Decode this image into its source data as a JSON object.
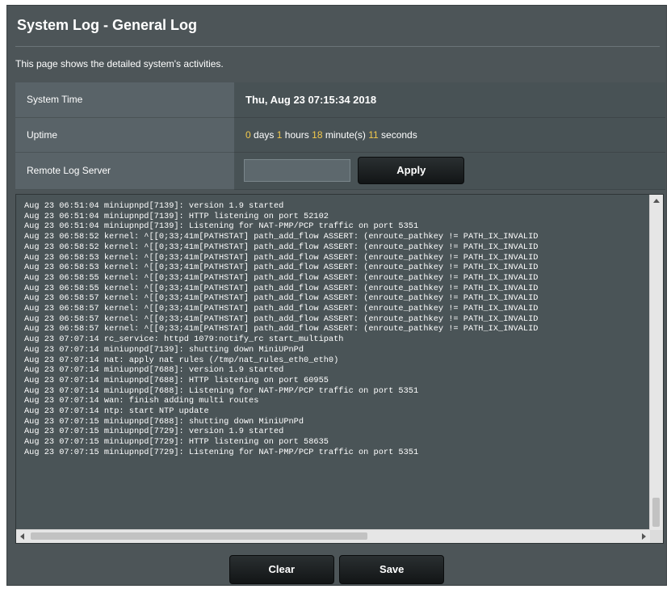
{
  "page": {
    "title": "System Log - General Log",
    "description": "This page shows the detailed system's activities."
  },
  "info": {
    "system_time_label": "System Time",
    "system_time_value": "Thu, Aug 23 07:15:34 2018",
    "uptime_label": "Uptime",
    "uptime": {
      "days": "0",
      "days_unit": "days",
      "hours": "1",
      "hours_unit": "hours",
      "minutes": "18",
      "minutes_unit": "minute(s)",
      "seconds": "11",
      "seconds_unit": "seconds"
    },
    "remote_log_label": "Remote Log Server",
    "remote_log_value": "",
    "apply_label": "Apply"
  },
  "log": {
    "lines": [
      "Aug 23 06:51:04 miniupnpd[7139]: version 1.9 started",
      "Aug 23 06:51:04 miniupnpd[7139]: HTTP listening on port 52102",
      "Aug 23 06:51:04 miniupnpd[7139]: Listening for NAT-PMP/PCP traffic on port 5351",
      "Aug 23 06:58:52 kernel: ^[[0;33;41m[PATHSTAT] path_add_flow ASSERT: (enroute_pathkey != PATH_IX_INVALID",
      "Aug 23 06:58:52 kernel: ^[[0;33;41m[PATHSTAT] path_add_flow ASSERT: (enroute_pathkey != PATH_IX_INVALID",
      "Aug 23 06:58:53 kernel: ^[[0;33;41m[PATHSTAT] path_add_flow ASSERT: (enroute_pathkey != PATH_IX_INVALID",
      "Aug 23 06:58:53 kernel: ^[[0;33;41m[PATHSTAT] path_add_flow ASSERT: (enroute_pathkey != PATH_IX_INVALID",
      "Aug 23 06:58:55 kernel: ^[[0;33;41m[PATHSTAT] path_add_flow ASSERT: (enroute_pathkey != PATH_IX_INVALID",
      "Aug 23 06:58:55 kernel: ^[[0;33;41m[PATHSTAT] path_add_flow ASSERT: (enroute_pathkey != PATH_IX_INVALID",
      "Aug 23 06:58:57 kernel: ^[[0;33;41m[PATHSTAT] path_add_flow ASSERT: (enroute_pathkey != PATH_IX_INVALID",
      "Aug 23 06:58:57 kernel: ^[[0;33;41m[PATHSTAT] path_add_flow ASSERT: (enroute_pathkey != PATH_IX_INVALID",
      "Aug 23 06:58:57 kernel: ^[[0;33;41m[PATHSTAT] path_add_flow ASSERT: (enroute_pathkey != PATH_IX_INVALID",
      "Aug 23 06:58:57 kernel: ^[[0;33;41m[PATHSTAT] path_add_flow ASSERT: (enroute_pathkey != PATH_IX_INVALID",
      "Aug 23 07:07:14 rc_service: httpd 1079:notify_rc start_multipath",
      "Aug 23 07:07:14 miniupnpd[7139]: shutting down MiniUPnPd",
      "Aug 23 07:07:14 nat: apply nat rules (/tmp/nat_rules_eth0_eth0)",
      "Aug 23 07:07:14 miniupnpd[7688]: version 1.9 started",
      "Aug 23 07:07:14 miniupnpd[7688]: HTTP listening on port 60955",
      "Aug 23 07:07:14 miniupnpd[7688]: Listening for NAT-PMP/PCP traffic on port 5351",
      "Aug 23 07:07:14 wan: finish adding multi routes",
      "Aug 23 07:07:14 ntp: start NTP update",
      "Aug 23 07:07:15 miniupnpd[7688]: shutting down MiniUPnPd",
      "Aug 23 07:07:15 miniupnpd[7729]: version 1.9 started",
      "Aug 23 07:07:15 miniupnpd[7729]: HTTP listening on port 58635",
      "Aug 23 07:07:15 miniupnpd[7729]: Listening for NAT-PMP/PCP traffic on port 5351"
    ]
  },
  "actions": {
    "clear_label": "Clear",
    "save_label": "Save"
  },
  "colors": {
    "panel_bg": "#4d5558",
    "label_cell_bg": "#596368",
    "value_cell_bg": "#485255",
    "uptime_number": "#f2c94c",
    "button_bg": "#121516"
  }
}
